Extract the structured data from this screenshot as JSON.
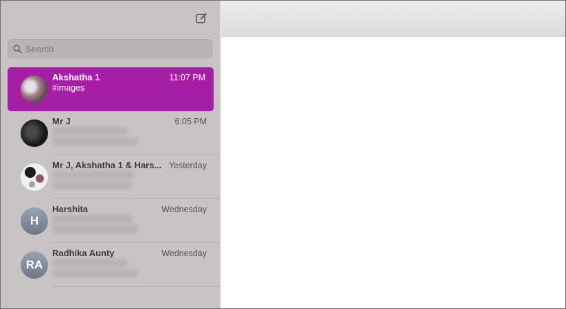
{
  "search": {
    "placeholder": "Search"
  },
  "conversations": [
    {
      "name": "Akshatha 1",
      "time": "11:07 PM",
      "preview": "#images",
      "selected": true
    },
    {
      "name": "Mr J",
      "time": "6:05 PM"
    },
    {
      "name": "Mr J, Akshatha 1 & Hars...",
      "time": "Yesterday"
    },
    {
      "name": "Harshita",
      "time": "Wednesday",
      "initials": "H"
    },
    {
      "name": "Radhika Aunty",
      "time": "Wednesday",
      "initials": "RA"
    }
  ],
  "icons": {
    "compose": "compose-icon",
    "search": "search-icon"
  },
  "colors": {
    "selected": "#a61ea6",
    "sidebar": "#c9c4c4"
  }
}
